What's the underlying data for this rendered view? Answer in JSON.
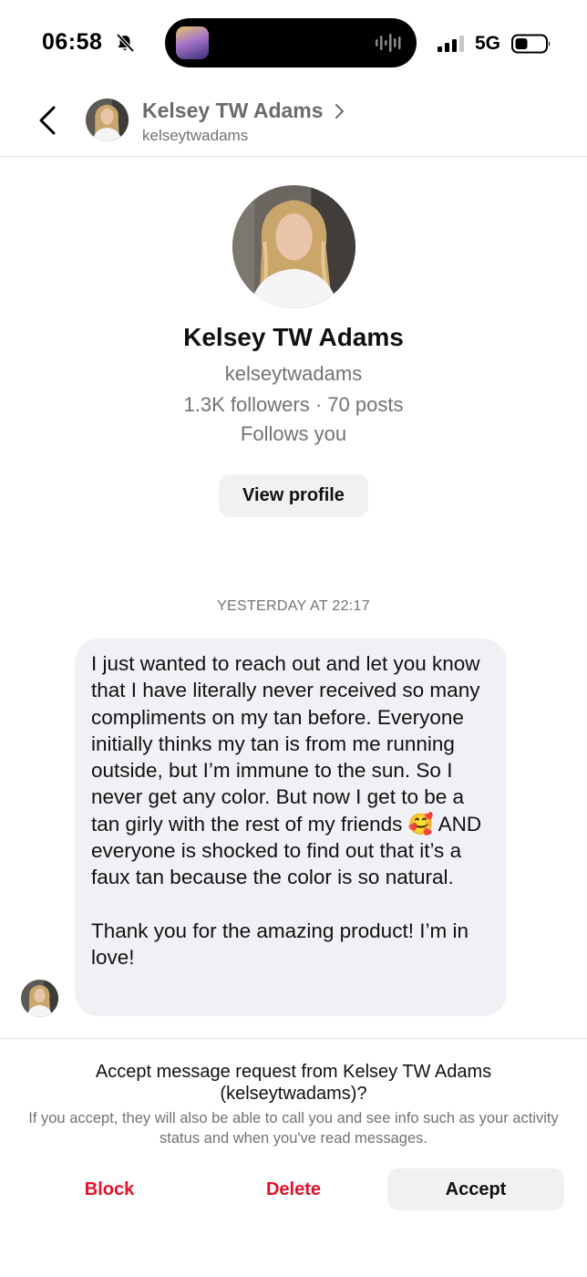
{
  "status_bar": {
    "time": "06:58",
    "network": "5G"
  },
  "header": {
    "name": "Kelsey TW Adams",
    "username": "kelseytwadams"
  },
  "profile": {
    "name": "Kelsey TW Adams",
    "username": "kelseytwadams",
    "stats": "1.3K followers · 70 posts",
    "follows_you": "Follows you",
    "view_profile_label": "View profile"
  },
  "conversation": {
    "timestamp": "YESTERDAY AT 22:17",
    "message": "I just wanted to reach out and let you know that I have literally never received so many compliments on my tan before. Everyone initially thinks my tan is from me running outside, but I’m immune to the sun. So I never get any color. But now I get to be a tan girly with the rest of my friends 🥰 AND everyone is shocked to find out that it’s a faux tan because the color is so natural.\n\nThank you for the amazing product! I’m in love!"
  },
  "request": {
    "title": "Accept message request from Kelsey TW Adams (kelseytwadams)?",
    "description": "If you accept, they will also be able to call you and see info such as your activity status and when you've read messages.",
    "block_label": "Block",
    "delete_label": "Delete",
    "accept_label": "Accept"
  },
  "colors": {
    "destructive": "#e4112b",
    "bubble": "#eff1f4",
    "button": "#eff1f3",
    "secondary_text": "#737373"
  }
}
